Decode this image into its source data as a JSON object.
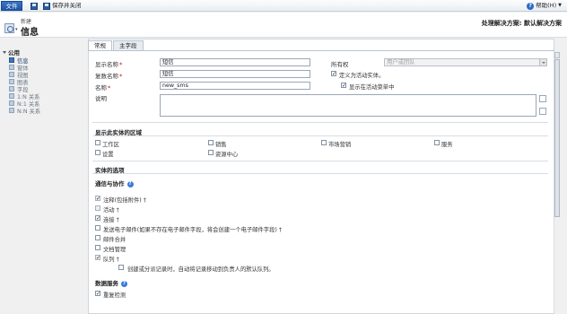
{
  "toolbar": {
    "file_label": "文件",
    "save_close_label": "保存并关闭",
    "help_label": "帮助(H)"
  },
  "header": {
    "new_label": "新建",
    "title": "信息",
    "solution_label": "处理解决方案: 默认解决方案"
  },
  "leftnav": {
    "group_label": "公用",
    "items": [
      {
        "label": "信息",
        "active": true
      },
      {
        "label": "窗体",
        "active": false
      },
      {
        "label": "视图",
        "active": false
      },
      {
        "label": "图表",
        "active": false
      },
      {
        "label": "字段",
        "active": false
      },
      {
        "label": "1:N 关系",
        "active": false
      },
      {
        "label": "N:1 关系",
        "active": false
      },
      {
        "label": "N:N 关系",
        "active": false
      }
    ]
  },
  "tabs": [
    {
      "label": "常规",
      "active": true
    },
    {
      "label": "主字段",
      "active": false
    }
  ],
  "general": {
    "display_name_label": "显示名称",
    "display_name_value": "短信",
    "plural_name_label": "复数名称",
    "plural_name_value": "短信",
    "name_label": "名称",
    "name_value": "new_sms",
    "description_label": "说明",
    "ownership_label": "所有权",
    "ownership_value": "用户或团队",
    "define_activity_label": "定义为活动实体。",
    "show_in_activity_menu_label": "显示在活动菜单中",
    "required_mark": "*"
  },
  "areas": {
    "section_title": "显示此实体的区域",
    "items": [
      {
        "label": "工作区",
        "checked": false
      },
      {
        "label": "销售",
        "checked": false
      },
      {
        "label": "市场营销",
        "checked": false
      },
      {
        "label": "服务",
        "checked": false
      },
      {
        "label": "设置",
        "checked": false
      },
      {
        "label": "资源中心",
        "checked": false
      }
    ]
  },
  "options": {
    "section_title": "实体的选项",
    "communication_title": "通信与协作",
    "items": [
      {
        "label": "注释(包括附件) †",
        "checked": true,
        "disabled": true
      },
      {
        "label": "活动 †",
        "checked": false,
        "disabled": true
      },
      {
        "label": "连接 †",
        "checked": true,
        "disabled": false
      },
      {
        "label": "发送电子邮件(如果不存在电子邮件字段，将会创建一个电子邮件字段) †",
        "checked": false,
        "disabled": false
      },
      {
        "label": "邮件合并",
        "checked": false,
        "disabled": false
      },
      {
        "label": "文档管理",
        "checked": false,
        "disabled": false
      },
      {
        "label": "队列 †",
        "checked": true,
        "disabled": true
      }
    ],
    "queue_sub_label": "创建或分派记录时，自动将记录移动到负责人的默认队列。",
    "data_services_title": "数据服务",
    "dup_detect_label": "重复检测"
  }
}
